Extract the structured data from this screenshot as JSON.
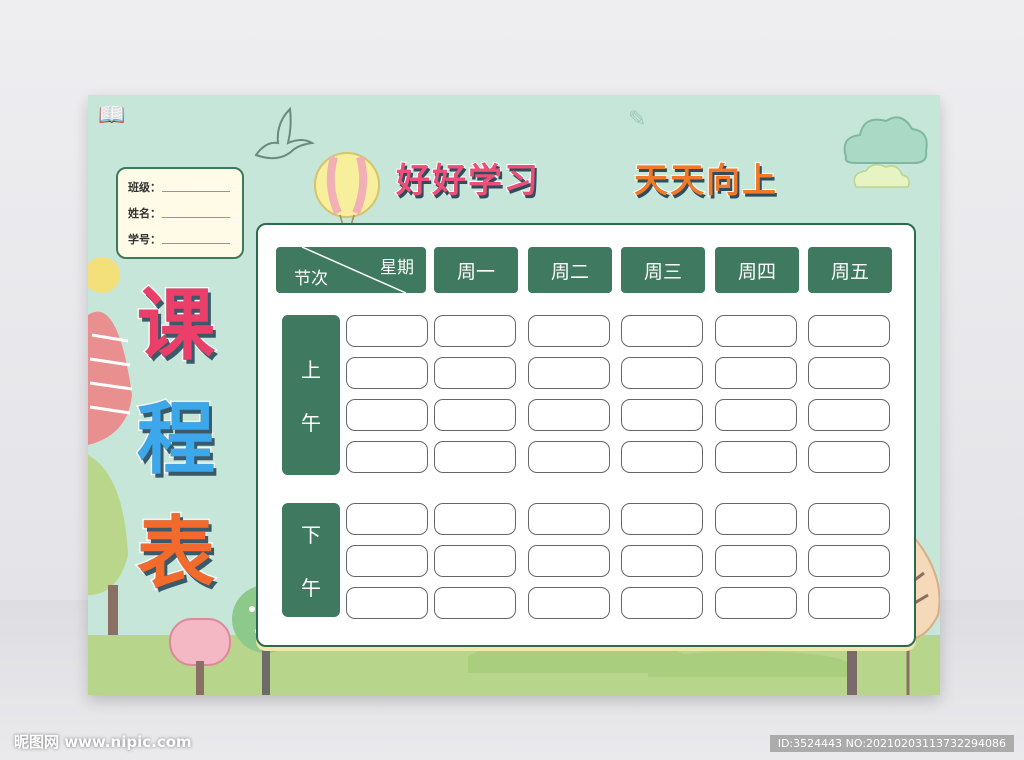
{
  "slogan": {
    "part1": "好好学习",
    "part2": "天天向上"
  },
  "title": [
    "课",
    "程",
    "表"
  ],
  "info_card": {
    "class_label": "班级：",
    "name_label": "姓名：",
    "id_label": "学号："
  },
  "table": {
    "corner_top": "星期",
    "corner_bottom": "节次",
    "days": [
      "周一",
      "周二",
      "周三",
      "周四",
      "周五"
    ],
    "morning": [
      "上",
      "午"
    ],
    "afternoon": [
      "下",
      "午"
    ]
  },
  "watermark": {
    "left": "昵图网 www.nipic.com",
    "right": "ID:3524443 NO:20210203113732294086"
  },
  "colors": {
    "header_green": "#3f7a60",
    "poster_bg": "#c5e6d8",
    "title_1": "#e8365d",
    "title_2": "#3aa6e8",
    "title_3": "#f06a2a"
  },
  "icons": [
    "bird-icon",
    "balloon-icon",
    "cloud-icon",
    "tree-icon"
  ]
}
